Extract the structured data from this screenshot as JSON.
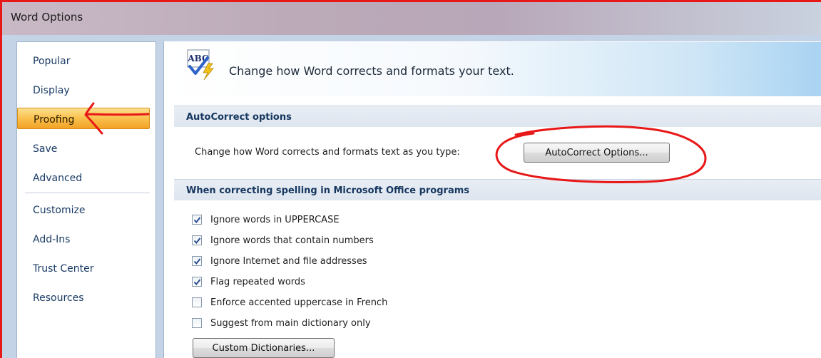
{
  "window": {
    "title": "Word Options"
  },
  "sidebar": {
    "items": [
      {
        "label": "Popular"
      },
      {
        "label": "Display"
      },
      {
        "label": "Proofing",
        "selected": true
      },
      {
        "label": "Save"
      },
      {
        "label": "Advanced"
      },
      {
        "label": "Customize"
      },
      {
        "label": "Add-Ins"
      },
      {
        "label": "Trust Center"
      },
      {
        "label": "Resources"
      }
    ]
  },
  "main": {
    "header": {
      "text": "Change how Word corrects and formats your text.",
      "icon": "abc-spellcheck-icon"
    },
    "autocorrect": {
      "heading": "AutoCorrect options",
      "description": "Change how Word corrects and formats text as you type:",
      "button_label": "AutoCorrect Options..."
    },
    "spelling": {
      "heading": "When correcting spelling in Microsoft Office programs",
      "options": [
        {
          "label": "Ignore words in UPPERCASE",
          "checked": true
        },
        {
          "label": "Ignore words that contain numbers",
          "checked": true
        },
        {
          "label": "Ignore Internet and file addresses",
          "checked": true
        },
        {
          "label": "Flag repeated words",
          "checked": true
        },
        {
          "label": "Enforce accented uppercase in French",
          "checked": false
        },
        {
          "label": "Suggest from main dictionary only",
          "checked": false
        }
      ],
      "custom_dictionaries_label": "Custom Dictionaries..."
    }
  },
  "colors": {
    "selected_nav": "#f9c04c",
    "annotation": "#e81818",
    "section_heading": "#15365e"
  }
}
